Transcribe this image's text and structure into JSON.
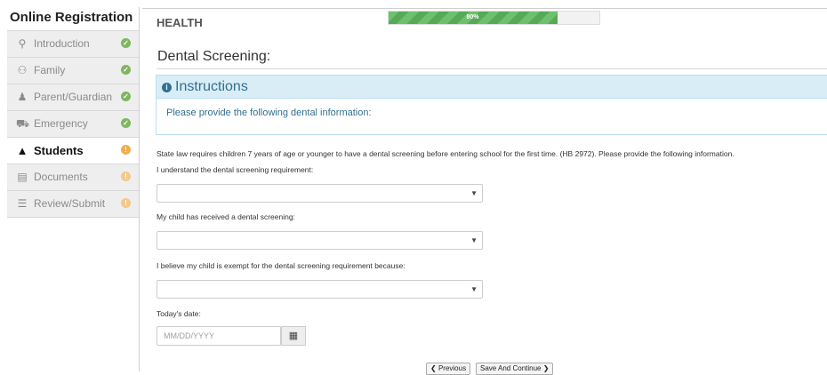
{
  "sidebar": {
    "title": "Online Registration",
    "items": [
      {
        "label": "Introduction",
        "icon": "lightbulb-icon",
        "status": "complete"
      },
      {
        "label": "Family",
        "icon": "family-icon",
        "status": "complete"
      },
      {
        "label": "Parent/Guardian",
        "icon": "user-icon",
        "status": "complete"
      },
      {
        "label": "Emergency",
        "icon": "ambulance-icon",
        "status": "complete"
      },
      {
        "label": "Students",
        "icon": "graduation-cap-icon",
        "status": "incomplete",
        "active": true
      },
      {
        "label": "Documents",
        "icon": "document-icon",
        "status": "incomplete"
      },
      {
        "label": "Review/Submit",
        "icon": "list-icon",
        "status": "incomplete"
      }
    ]
  },
  "header": {
    "section": "HEALTH",
    "progress": {
      "value": 0.8,
      "label": "80%"
    }
  },
  "page_title": "Dental Screening:",
  "instructions": {
    "title": "Instructions",
    "body": "Please provide the following dental information:"
  },
  "statement": "State law requires children 7 years of age or younger to have a dental screening before entering school for the first time. (HB 2972). Please provide the following information.",
  "form": {
    "q1_label": "I understand the dental screening requirement:",
    "q2_label": "My child has received a dental screening:",
    "q3_label": "I believe my child is exempt for the dental screening requirement because:",
    "date_label": "Today's date:",
    "date_placeholder": "MM/DD/YYYY"
  },
  "buttons": {
    "previous": "Previous",
    "save_continue": "Save And Continue"
  },
  "colors": {
    "progress": "#5cb85c",
    "complete_badge": "#80b55f",
    "incomplete_badge": "#f0ad4e",
    "info_text": "#31708f",
    "info_bg": "#d9edf7"
  }
}
